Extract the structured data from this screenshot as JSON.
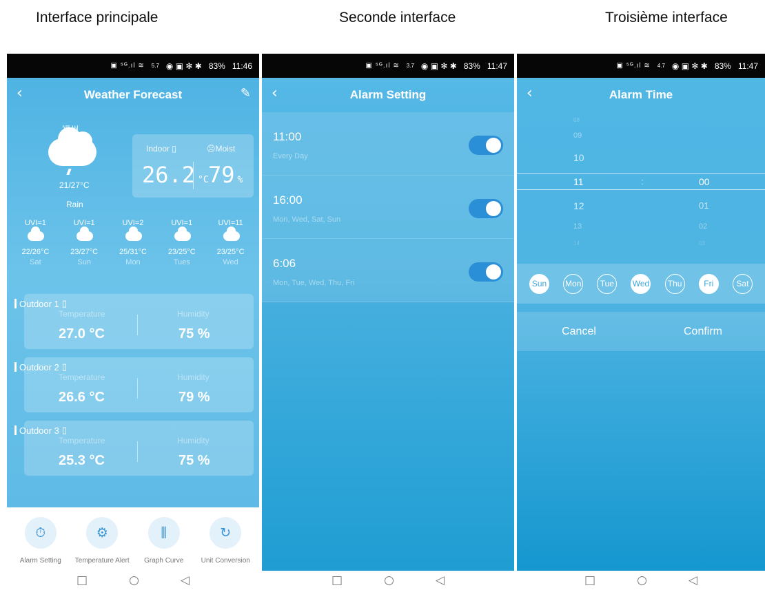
{
  "captions": [
    "Interface principale",
    "Seconde interface",
    "Troisième interface"
  ],
  "status": [
    {
      "speed": "5.7",
      "battery": "83%",
      "time": "11:46"
    },
    {
      "speed": "3.7",
      "battery": "83%",
      "time": "11:47"
    },
    {
      "speed": "4.7",
      "battery": "83%",
      "time": "11:47"
    }
  ],
  "weather": {
    "title": "Weather Forecast",
    "city": "福州",
    "temp_range": "21/27°C",
    "condition": "Rain",
    "indoor_label": "Indoor",
    "moist_label": "Moist",
    "indoor_temp": "26.2",
    "indoor_unit": "°C",
    "moist_value": "79",
    "moist_unit": "%",
    "forecast": [
      {
        "uvi": "UVI=1",
        "temp": "22/26°C",
        "day": "Sat",
        "icon": "rain-cloud-icon"
      },
      {
        "uvi": "UVI=1",
        "temp": "23/27°C",
        "day": "Sun",
        "icon": "light-rain-cloud-icon"
      },
      {
        "uvi": "UVI=2",
        "temp": "25/31°C",
        "day": "Mon",
        "icon": "cloud-icon"
      },
      {
        "uvi": "UVI=1",
        "temp": "23/25°C",
        "day": "Tues",
        "icon": "rain-cloud-icon"
      },
      {
        "uvi": "UVI=11",
        "temp": "23/25°C",
        "day": "Wed",
        "icon": "light-rain-cloud-icon"
      }
    ],
    "outdoor": [
      {
        "name": "Outdoor 1",
        "temp_label": "Temperature",
        "hum_label": "Humidity",
        "temp": "27.0 °C",
        "hum": "75 %"
      },
      {
        "name": "Outdoor 2",
        "temp_label": "Temperature",
        "hum_label": "Humidity",
        "temp": "26.6 °C",
        "hum": "79 %"
      },
      {
        "name": "Outdoor 3",
        "temp_label": "Temperature",
        "hum_label": "Humidity",
        "temp": "25.3 °C",
        "hum": "75 %"
      }
    ],
    "tools": [
      {
        "label": "Alarm Setting",
        "icon": "timer-icon"
      },
      {
        "label": "Temperature Alert",
        "icon": "gear-icon"
      },
      {
        "label": "Graph Curve",
        "icon": "chart-icon"
      },
      {
        "label": "Unit Conversion",
        "icon": "refresh-icon"
      }
    ]
  },
  "alarms": {
    "title": "Alarm Setting",
    "items": [
      {
        "time": "11:00",
        "days": "Every Day",
        "enabled": true
      },
      {
        "time": "16:00",
        "days": "Mon, Wed, Sat, Sun",
        "enabled": true
      },
      {
        "time": "6:06",
        "days": "Mon, Tue, Wed, Thu, Fri",
        "enabled": true
      }
    ]
  },
  "alarm_time": {
    "title": "Alarm Time",
    "hours": [
      "08",
      "09",
      "10",
      "11",
      "12",
      "13",
      "14"
    ],
    "minutes": [
      "00",
      "01",
      "02",
      "03"
    ],
    "separator": ":",
    "weekdays": [
      {
        "label": "Sun",
        "selected": false
      },
      {
        "label": "Mon",
        "selected": true
      },
      {
        "label": "Tue",
        "selected": true
      },
      {
        "label": "Wed",
        "selected": false
      },
      {
        "label": "Thu",
        "selected": true
      },
      {
        "label": "Fri",
        "selected": false
      },
      {
        "label": "Sat",
        "selected": true
      }
    ],
    "cancel": "Cancel",
    "confirm": "Confirm"
  }
}
